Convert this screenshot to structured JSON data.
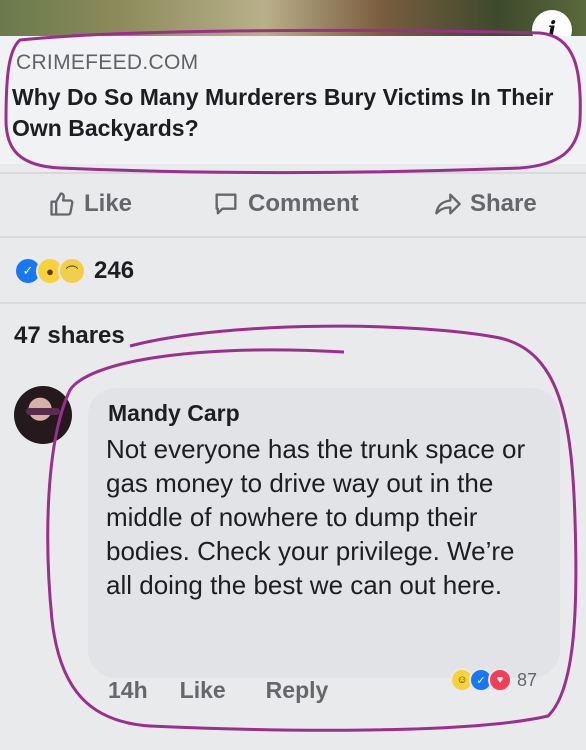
{
  "post": {
    "link_domain": "CRIMEFEED.COM",
    "link_title": "Why Do So Many Murderers Bury Victims In Their Own Backyards?",
    "info_label": "i"
  },
  "actions": {
    "like": "Like",
    "comment": "Comment",
    "share": "Share"
  },
  "stats": {
    "reaction_count": "246",
    "shares": "47 shares",
    "reaction_icons": [
      "like-reaction-icon",
      "wow-reaction-icon",
      "sad-reaction-icon"
    ]
  },
  "comment": {
    "author": "Mandy Carp",
    "text": "Not everyone has the trunk space or gas money to drive way out in the middle of nowhere to dump their bodies. Check your privilege. We’re all doing the best we can out here.",
    "time": "14h",
    "like": "Like",
    "reply": "Reply",
    "reaction_count": "87",
    "reaction_icons": [
      "haha-reaction-icon",
      "like-reaction-icon",
      "love-reaction-icon"
    ]
  },
  "colors": {
    "annotation": "#9b2f8c",
    "like_blue": "#1877f2",
    "muted_text": "#65676b"
  }
}
